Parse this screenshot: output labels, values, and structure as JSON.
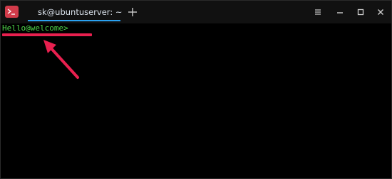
{
  "window": {
    "tab_title": "sk@ubuntuserver: ~",
    "icons": {
      "app": "terminal-icon",
      "new_tab": "plus-icon",
      "menu": "hamburger-menu-icon",
      "minimize": "minimize-icon",
      "maximize": "maximize-icon",
      "close": "close-icon"
    }
  },
  "terminal": {
    "prompt": "Hello@welcome>"
  },
  "annotation": {
    "color": "#e8204f"
  },
  "colors": {
    "tab_accent": "#2aa1f0",
    "prompt_text": "#4fd64a",
    "app_icon_bg": "#d23b4a"
  }
}
